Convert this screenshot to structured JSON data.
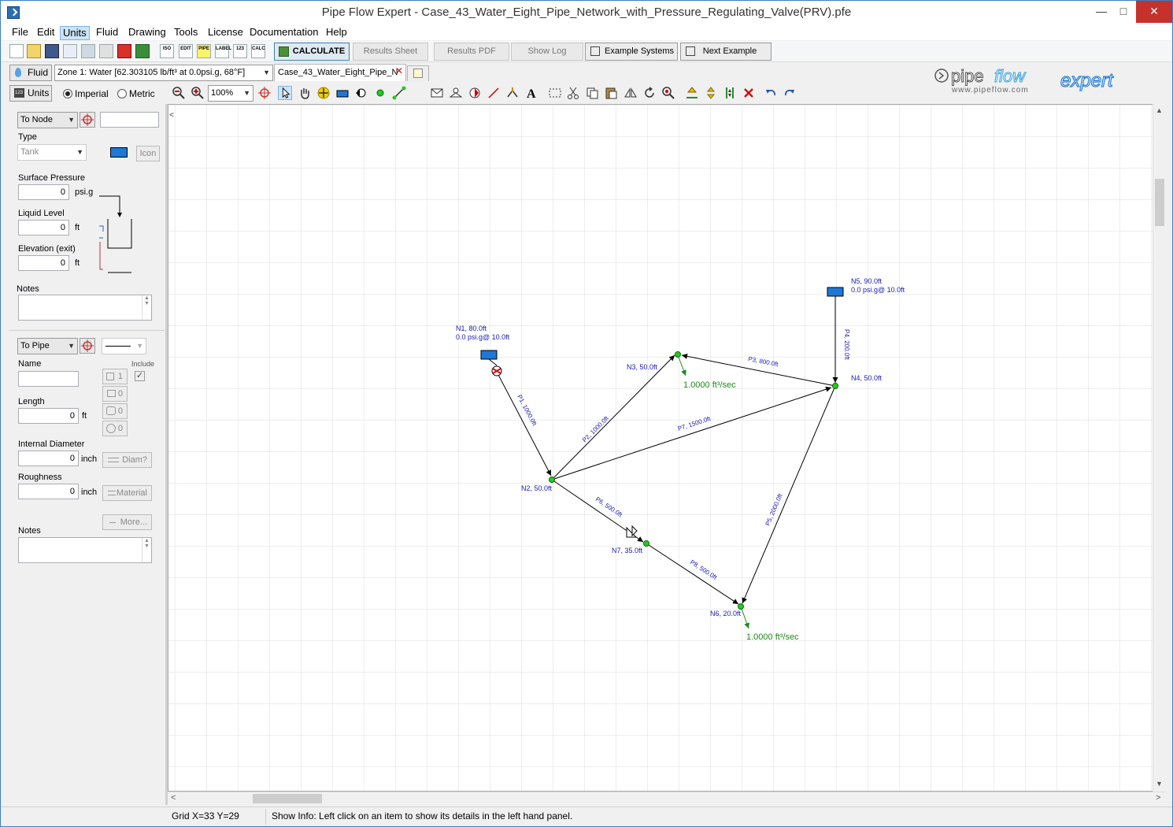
{
  "window": {
    "title": "Pipe Flow Expert - Case_43_Water_Eight_Pipe_Network_with_Pressure_Regulating_Valve(PRV).pfe"
  },
  "menu": [
    "File",
    "Edit",
    "Units",
    "Fluid",
    "Drawing",
    "Tools",
    "License",
    "Documentation",
    "Help"
  ],
  "menu_active": "Units",
  "toolbar": {
    "calculate": "CALCULATE",
    "results_sheet": "Results Sheet",
    "results_pdf": "Results PDF",
    "show_log": "Show Log",
    "example_systems": "Example Systems",
    "next_example": "Next Example",
    "small_labels": [
      "ISO",
      "EDIT",
      "PIPE",
      "LABEL",
      "123",
      "CALC"
    ]
  },
  "fluid": {
    "button": "Fluid",
    "zone": "Zone 1: Water [62.303105 lb/ft³ at 0.0psi.g, 68°F]",
    "tab": "Case_43_Water_Eight_Pipe_N"
  },
  "units": {
    "button": "Units",
    "imperial": "Imperial",
    "metric": "Metric",
    "selected": "imperial"
  },
  "zoom": "100%",
  "logo": {
    "name_a": "pipe",
    "name_b": "flow",
    "name_c": "expert",
    "url": "www.pipeflow.com"
  },
  "node_panel": {
    "to_node": "To Node",
    "type_label": "Type",
    "type_value": "Tank",
    "icon_btn": "Icon",
    "surface_pressure_label": "Surface Pressure",
    "surface_pressure_value": "0",
    "surface_pressure_unit": "psi.g",
    "liquid_level_label": "Liquid Level",
    "liquid_level_value": "0",
    "liquid_level_unit": "ft",
    "elevation_label": "Elevation (exit)",
    "elevation_value": "0",
    "elevation_unit": "ft",
    "notes_label": "Notes"
  },
  "pipe_panel": {
    "to_pipe": "To Pipe",
    "name_label": "Name",
    "include_label": "Include",
    "fitting_counts": [
      "1",
      "0",
      "0",
      "0"
    ],
    "length_label": "Length",
    "length_value": "0",
    "length_unit": "ft",
    "diameter_label": "Internal Diameter",
    "diameter_value": "0",
    "diameter_unit": "inch",
    "diam_btn": "Diam?",
    "roughness_label": "Roughness",
    "roughness_value": "0",
    "roughness_unit": "inch",
    "material_btn": "Material",
    "more_btn": "More...",
    "notes_label": "Notes"
  },
  "network": {
    "nodes": [
      {
        "id": "N1",
        "label1": "N1, 80.0ft",
        "label2": "0.0 psi.g@ 10.0ft",
        "type": "tank"
      },
      {
        "id": "N2",
        "label1": "N2, 50.0ft",
        "type": "join"
      },
      {
        "id": "N3",
        "label1": "N3, 50.0ft",
        "type": "join"
      },
      {
        "id": "N4",
        "label1": "N4, 50.0ft",
        "type": "join"
      },
      {
        "id": "N5",
        "label1": "N5, 90.0ft",
        "label2": "0.0 psi.g@ 10.0ft",
        "type": "tank"
      },
      {
        "id": "N6",
        "label1": "N6, 20.0ft",
        "type": "join"
      },
      {
        "id": "N7",
        "label1": "N7, 35.0ft",
        "type": "join"
      }
    ],
    "pipes": [
      {
        "id": "P1",
        "label": "P1, 1000.0ft"
      },
      {
        "id": "P2",
        "label": "P2, 1000.0ft"
      },
      {
        "id": "P3",
        "label": "P3, 800.0ft"
      },
      {
        "id": "P4",
        "label": "P4, 200.0ft"
      },
      {
        "id": "P5",
        "label": "P5, 2000.0ft"
      },
      {
        "id": "P6",
        "label": "P6, 500.0ft"
      },
      {
        "id": "P7",
        "label": "P7, 1500.0ft"
      },
      {
        "id": "P8",
        "label": "P8, 500.0ft"
      }
    ],
    "demands": [
      {
        "node": "N3",
        "label": "1.0000 ft³/sec"
      },
      {
        "node": "N6",
        "label": "1.0000 ft³/sec"
      }
    ]
  },
  "status": {
    "grid": "Grid  X=33  Y=29",
    "info": "Show Info: Left click on an item to show its details in the left hand panel."
  },
  "colors": {
    "label_blue": "#1a1ab4",
    "demand_green": "#1c8a1c",
    "node_green": "#22cc22",
    "tank_blue": "#1e78d8"
  }
}
